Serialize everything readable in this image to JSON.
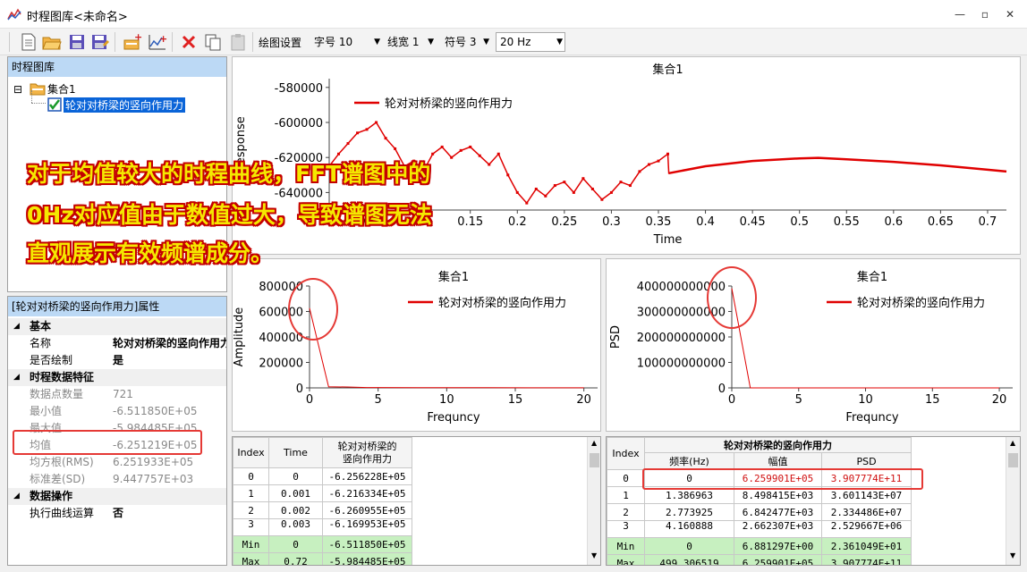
{
  "window": {
    "title": "时程图库<未命名>"
  },
  "toolbar": {
    "plot_settings_label": "绘图设置",
    "font_size": "字号 10",
    "line_width": "线宽 1",
    "symbol": "符号 3",
    "frequency": "20 Hz"
  },
  "tree": {
    "header": "时程图库",
    "root": "集合1",
    "child": "轮对对桥梁的竖向作用力"
  },
  "props": {
    "header": "[轮对对桥梁的竖向作用力]属性",
    "cat_basic": "基本",
    "name_k": "名称",
    "name_v": "轮对对桥梁的竖向作用力",
    "draw_k": "是否绘制",
    "draw_v": "是",
    "cat_features": "时程数据特征",
    "count_k": "数据点数量",
    "count_v": "721",
    "min_k": "最小值",
    "min_v": "-6.511850E+05",
    "max_k": "最大值",
    "max_v": "-5.984485E+05",
    "mean_k": "均值",
    "mean_v": "-6.251219E+05",
    "rms_k": "均方根(RMS)",
    "rms_v": "6.251933E+05",
    "sd_k": "标准差(SD)",
    "sd_v": "9.447757E+03",
    "cat_ops": "数据操作",
    "op_k": "执行曲线运算",
    "op_v": "否"
  },
  "overlay": {
    "line1": "对于均值较大的时程曲线，FFT谱图中的",
    "line2": "0Hz对应值由于数值过大，导致谱图无法",
    "line3": "直观展示有效频谱成分。"
  },
  "chart_data": [
    {
      "type": "line",
      "title": "集合1",
      "xlabel": "Time",
      "ylabel": "Response",
      "legend": "轮对对桥梁的竖向作用力",
      "xlim": [
        0,
        0.72
      ],
      "ylim": [
        -650000,
        -575000
      ],
      "xticks": [
        0,
        0.05,
        0.1,
        0.15,
        0.2,
        0.25,
        0.3,
        0.35,
        0.4,
        0.45,
        0.5,
        0.55,
        0.6,
        0.65,
        0.7
      ],
      "xtick_labels": [
        "0",
        "0.05",
        "0.1",
        "0.15",
        "0.2",
        "0.25",
        "0.3",
        "0.35",
        "0.4",
        "0.45",
        "0.5",
        "0.55",
        "0.6",
        "0.65",
        "0.7"
      ],
      "yticks": [
        -580000,
        -600000,
        -620000,
        -640000
      ],
      "ytick_labels": [
        "-580000",
        "-600000",
        "-620000",
        "-640000"
      ],
      "x": [
        0,
        0.01,
        0.02,
        0.03,
        0.04,
        0.05,
        0.06,
        0.07,
        0.08,
        0.09,
        0.1,
        0.11,
        0.12,
        0.13,
        0.14,
        0.15,
        0.16,
        0.17,
        0.18,
        0.19,
        0.2,
        0.21,
        0.22,
        0.23,
        0.24,
        0.25,
        0.26,
        0.27,
        0.28,
        0.29,
        0.3,
        0.31,
        0.32,
        0.33,
        0.34,
        0.35,
        0.36,
        0.361,
        0.4,
        0.45,
        0.5,
        0.52,
        0.55,
        0.6,
        0.65,
        0.7,
        0.72
      ],
      "y": [
        -625000,
        -618000,
        -612000,
        -606000,
        -604000,
        -600000,
        -609000,
        -615000,
        -625000,
        -622000,
        -628000,
        -618000,
        -614000,
        -620000,
        -616000,
        -614000,
        -619000,
        -624000,
        -618000,
        -630000,
        -640000,
        -646000,
        -638000,
        -642000,
        -636000,
        -634000,
        -640000,
        -632000,
        -638000,
        -644000,
        -640000,
        -634000,
        -636000,
        -628000,
        -624000,
        -622000,
        -618000,
        -629000,
        -625000,
        -622000,
        -620500,
        -620200,
        -621000,
        -622500,
        -624500,
        -627000,
        -628000
      ]
    },
    {
      "type": "line",
      "title": "集合1",
      "xlabel": "Frequncy",
      "ylabel": "Amplitude",
      "legend": "轮对对桥梁的竖向作用力",
      "xlim": [
        0,
        21
      ],
      "ylim": [
        0,
        800000
      ],
      "xticks": [
        0,
        5,
        10,
        15,
        20
      ],
      "xtick_labels": [
        "0",
        "5",
        "10",
        "15",
        "20"
      ],
      "yticks": [
        0,
        200000,
        400000,
        600000,
        800000
      ],
      "ytick_labels": [
        "0",
        "200000",
        "400000",
        "600000",
        "800000"
      ],
      "x": [
        0,
        1.386963,
        2.773925,
        4.16,
        5,
        8,
        10,
        13,
        16,
        20
      ],
      "y": [
        625990.1,
        8498.415,
        6842.477,
        3000,
        2500,
        2000,
        1500,
        1200,
        1000,
        900
      ]
    },
    {
      "type": "line",
      "title": "集合1",
      "xlabel": "Frequncy",
      "ylabel": "PSD",
      "legend": "轮对对桥梁的竖向作用力",
      "xlim": [
        0,
        21
      ],
      "ylim": [
        0,
        400000000000
      ],
      "xticks": [
        0,
        5,
        10,
        15,
        20
      ],
      "xtick_labels": [
        "0",
        "5",
        "10",
        "15",
        "20"
      ],
      "yticks": [
        0,
        100000000000,
        200000000000,
        300000000000,
        400000000000
      ],
      "ytick_labels": [
        "0",
        "100000000000",
        "200000000000",
        "300000000000",
        "400000000000"
      ],
      "x": [
        0,
        1.386963,
        2.773925,
        4.16,
        10,
        20
      ],
      "y": [
        390777400000,
        36011430,
        23348860,
        5000000,
        1000000,
        500000
      ]
    }
  ],
  "table1": {
    "headers": [
      "Index",
      "Time",
      "轮对对桥梁的",
      "竖向作用力"
    ],
    "rows": [
      [
        "0",
        "0",
        "-6.256228E+05"
      ],
      [
        "1",
        "0.001",
        "-6.216334E+05"
      ],
      [
        "2",
        "0.002",
        "-6.260955E+05"
      ],
      [
        "3",
        "0.003",
        "-6.169953E+05"
      ]
    ],
    "min": [
      "Min",
      "0",
      "-6.511850E+05"
    ],
    "max": [
      "Max",
      "0.72",
      "-5.984485E+05"
    ]
  },
  "table2": {
    "header_index": "Index",
    "header_group": "轮对对桥梁的竖向作用力",
    "headers": [
      "频率(Hz)",
      "幅值",
      "PSD"
    ],
    "rows": [
      [
        "0",
        "0",
        "6.259901E+05",
        "3.907774E+11"
      ],
      [
        "1",
        "1.386963",
        "8.498415E+03",
        "3.601143E+07"
      ],
      [
        "2",
        "2.773925",
        "6.842477E+03",
        "2.334486E+07"
      ],
      [
        "3",
        "4.160888",
        "2.662307E+03",
        "2.529667E+06"
      ]
    ],
    "min": [
      "Min",
      "0",
      "6.881297E+00",
      "2.361049E+01"
    ],
    "max": [
      "Max",
      "499.306519",
      "6.259901E+05",
      "3.907774E+11"
    ]
  }
}
